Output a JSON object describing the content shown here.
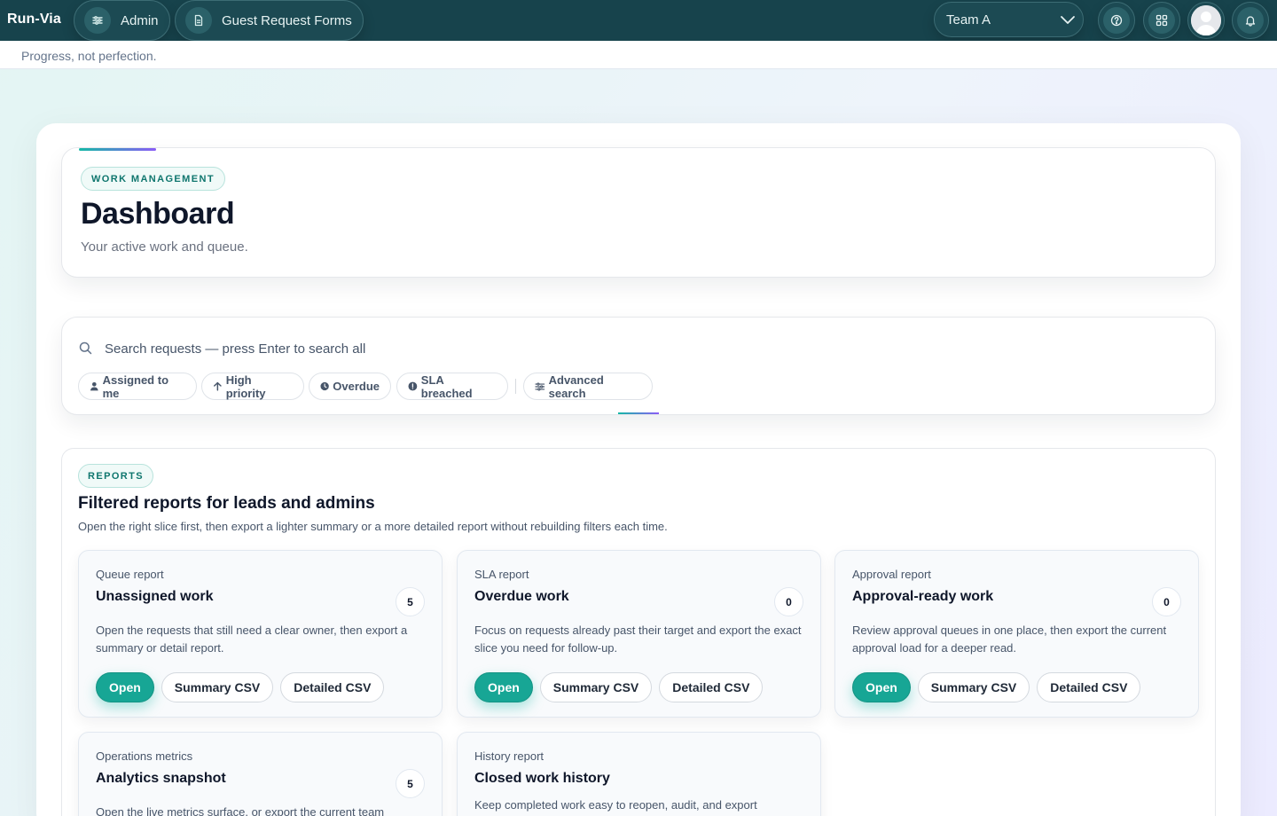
{
  "app": {
    "brand": "Run-Via",
    "tagline": "Progress, not perfection."
  },
  "nav": {
    "admin_label": "Admin",
    "forms_label": "Guest Request Forms"
  },
  "team_select": {
    "value": "Team A"
  },
  "header": {
    "eyebrow": "WORK MANAGEMENT",
    "title": "Dashboard",
    "subtitle": "Your active work and queue."
  },
  "search": {
    "placeholder": "Search requests — press Enter to search all",
    "chips": {
      "assigned": "Assigned to me",
      "high": "High priority",
      "overdue": "Overdue",
      "sla": "SLA breached",
      "advanced": "Advanced search"
    }
  },
  "reports": {
    "eyebrow": "REPORTS",
    "title": "Filtered reports for leads and admins",
    "subtitle": "Open the right slice first, then export a lighter summary or a more detailed report without rebuilding filters each time.",
    "cards": [
      {
        "kicker": "Queue report",
        "title": "Unassigned work",
        "count": "5",
        "description": "Open the requests that still need a clear owner, then export a summary or detail report.",
        "open_label": "Open",
        "summary_label": "Summary CSV",
        "detailed_label": "Detailed CSV"
      },
      {
        "kicker": "SLA report",
        "title": "Overdue work",
        "count": "0",
        "description": "Focus on requests already past their target and export the exact slice you need for follow-up.",
        "open_label": "Open",
        "summary_label": "Summary CSV",
        "detailed_label": "Detailed CSV"
      },
      {
        "kicker": "Approval report",
        "title": "Approval-ready work",
        "count": "0",
        "description": "Review approval queues in one place, then export the current approval load for a deeper read.",
        "open_label": "Open",
        "summary_label": "Summary CSV",
        "detailed_label": "Detailed CSV"
      },
      {
        "kicker": "Operations metrics",
        "title": "Analytics snapshot",
        "count": "5",
        "description": "Open the live metrics surface, or export the current team"
      },
      {
        "kicker": "History report",
        "title": "Closed work history",
        "description": "Keep completed work easy to reopen, audit, and export"
      }
    ]
  },
  "colors": {
    "topbar": "#17434c",
    "accent": "#17a695",
    "accent_gradient_end": "#8b5cf6"
  }
}
